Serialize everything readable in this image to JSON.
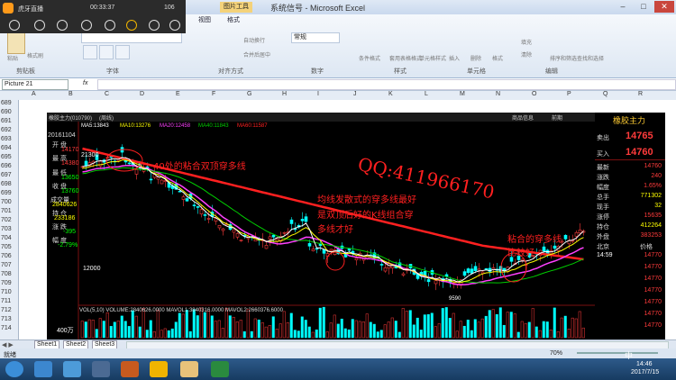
{
  "window": {
    "title": "系统信号 - Microsoft Excel",
    "context_tab": "图片工具"
  },
  "ribbon": {
    "tabs": [
      "视图",
      "格式"
    ],
    "groups": [
      "剪贴板",
      "字体",
      "对齐方式",
      "数字",
      "样式",
      "单元格",
      "编辑"
    ],
    "paste_label": "粘贴",
    "format_painter": "格式刷",
    "number_format": "常规",
    "wrap_text": "自动换行",
    "merge_center": "合并后居中",
    "cond_format": "条件格式",
    "table_format": "套用表格格式",
    "cell_style": "单元格样式",
    "insert": "插入",
    "delete": "删除",
    "format": "格式",
    "fill": "填充",
    "clear": "清除",
    "sort_filter": "排序和筛选",
    "find_select": "查找和选择"
  },
  "overlay": {
    "app": "虎牙直播",
    "time": "00:33:37",
    "viewers": "106"
  },
  "formula_bar": {
    "name_box": "Picture 21",
    "fx": "fx"
  },
  "columns": [
    "A",
    "B",
    "C",
    "D",
    "E",
    "F",
    "G",
    "H",
    "I",
    "J",
    "K",
    "L",
    "M",
    "N",
    "O",
    "P",
    "Q",
    "R"
  ],
  "rows": [
    "689",
    "690",
    "691",
    "692",
    "693",
    "694",
    "695",
    "696",
    "697",
    "698",
    "699",
    "700",
    "701",
    "702",
    "703",
    "704",
    "705",
    "706",
    "707",
    "708",
    "709",
    "710",
    "711",
    "712",
    "713",
    "714",
    "715"
  ],
  "stock": {
    "name": "橡胶主力(010790)",
    "period": "(周线)",
    "ma_legend": [
      "MA5:13843",
      "MA10:13276",
      "MA20:12458",
      "MA40:11843",
      "MA60:11587"
    ],
    "product_info": "商品信息",
    "header_right": "前期",
    "date": "20161104",
    "left_labels": [
      {
        "label": "开 盘",
        "value": "14170"
      },
      {
        "label": "最 高",
        "value": "14380"
      },
      {
        "label": "最 低",
        "value": "13650"
      },
      {
        "label": "收 盘",
        "value": "13760"
      },
      {
        "label": "成交量",
        "value": "2840626"
      },
      {
        "label": "持 仓",
        "value": "233186"
      },
      {
        "label": "涨 跌",
        "value": "-395"
      },
      {
        "label": "幅 度",
        "value": "-2.79%"
      }
    ],
    "price_high": "21300",
    "price_mid": "12000",
    "price_low": "9590",
    "volume_legend": "VOL(5,10) VOLUME:2840626.0000 MAVOL1:3840316.0000 MAVOL2:2660376.6000",
    "volume_axis": "400万",
    "annotations": {
      "a1": "40处的粘合双顶穿多线",
      "a2": "均线发散式的穿多线最好",
      "a3": "是双顶后好的K线组合穿",
      "a4": "多线才好",
      "a5": "粘合的穿多线",
      "a6": "比较好",
      "qq": "QQ:411966170"
    }
  },
  "right_panel": {
    "title": "橡胶主力",
    "sell_label": "卖出",
    "sell_price": "14765",
    "buy_label": "买入",
    "buy_price": "14760",
    "items": [
      {
        "label": "最新",
        "value": "14760"
      },
      {
        "label": "涨跌",
        "value": "240"
      },
      {
        "label": "幅度",
        "value": "1.65%"
      },
      {
        "label": "总手",
        "value": "771302"
      },
      {
        "label": "现手",
        "value": "32"
      },
      {
        "label": "涨停",
        "value": "15635"
      },
      {
        "label": "持仓",
        "value": "412264"
      },
      {
        "label": "外盘",
        "value": "383253"
      }
    ],
    "market": "北京",
    "price_col": "价格",
    "ticks": [
      {
        "time": "14:59",
        "price": "14770"
      },
      {
        "time": "",
        "price": "14770"
      },
      {
        "time": "",
        "price": "14770"
      },
      {
        "time": "",
        "price": "14770"
      },
      {
        "time": "",
        "price": "14770"
      },
      {
        "time": "",
        "price": "14770"
      },
      {
        "time": "",
        "price": "14770"
      }
    ]
  },
  "sheets": [
    "Sheet1",
    "Sheet2",
    "Sheet3"
  ],
  "status": {
    "ready": "就绪",
    "zoom": "70%"
  },
  "taskbar": {
    "time": "14:46",
    "date": "2017/7/15",
    "ime": "中"
  },
  "colors": {
    "up": "#ff3b3b",
    "down": "#00ffff",
    "ma5": "#ffffff",
    "ma10": "#ffff00",
    "ma20": "#ff40ff",
    "ma40": "#00ff00",
    "ma60": "#ff2020"
  }
}
